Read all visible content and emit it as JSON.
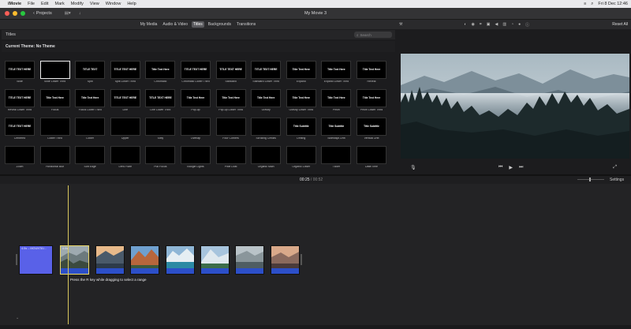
{
  "menubar": {
    "app": "iMovie",
    "items": [
      "File",
      "Edit",
      "Mark",
      "Modify",
      "View",
      "Window",
      "Help"
    ],
    "clock": "Fri 8 Dec  12:46"
  },
  "toolbar": {
    "projects_label": "Projects",
    "window_title": "My Movie 3"
  },
  "tabs": [
    {
      "label": "My Media",
      "active": false
    },
    {
      "label": "Audio & Video",
      "active": false
    },
    {
      "label": "Titles",
      "active": true
    },
    {
      "label": "Backgrounds",
      "active": false
    },
    {
      "label": "Transitions",
      "active": false
    }
  ],
  "viewer_toolbar": {
    "reset_label": "Reset All"
  },
  "browser": {
    "heading": "Titles",
    "search_placeholder": "Search",
    "current_theme": "Current Theme: No Theme"
  },
  "titles": [
    {
      "name": "Slide",
      "thumb": "TITLE TEXT HERE"
    },
    {
      "name": "Slide Lower Third",
      "thumb": "",
      "selected": true
    },
    {
      "name": "Split",
      "thumb": "TITLE TEXT"
    },
    {
      "name": "Split Lower Third",
      "thumb": "TITLE TEXT HERE"
    },
    {
      "name": "Chromatic",
      "thumb": "Title Text Here"
    },
    {
      "name": "Chromatic Lower Third",
      "thumb": "TITLE TEXT HERE"
    },
    {
      "name": "Standard",
      "thumb": "TITLE TEXT HERE"
    },
    {
      "name": "Standard Lower Third",
      "thumb": "TITLE TEXT HERE"
    },
    {
      "name": "Expand",
      "thumb": "Title Text Here"
    },
    {
      "name": "Expand Lower Third",
      "thumb": "Title Text Here"
    },
    {
      "name": "Reveal",
      "thumb": "Title Text Here"
    },
    {
      "name": "Reveal Lower Third",
      "thumb": "TITLE TEXT HERE"
    },
    {
      "name": "Focus",
      "thumb": "Title Text Here"
    },
    {
      "name": "Focus Lower Third",
      "thumb": "Title Text Here"
    },
    {
      "name": "Line",
      "thumb": "TITLE TEXT HERE"
    },
    {
      "name": "Line Lower Third",
      "thumb": "TITLE TEXT HERE"
    },
    {
      "name": "Pop-up",
      "thumb": "Title Text Here"
    },
    {
      "name": "Pop-up Lower Third",
      "thumb": "Title Text Here"
    },
    {
      "name": "Gravity",
      "thumb": "Title Text Here"
    },
    {
      "name": "Gravity Lower Third",
      "thumb": "Title Text Here"
    },
    {
      "name": "Prism",
      "thumb": "Title Text Here"
    },
    {
      "name": "Prism Lower Third",
      "thumb": "Title Text Here"
    },
    {
      "name": "Centered",
      "thumb": "TITLE TEXT HERE"
    },
    {
      "name": "Lower Third",
      "thumb": ""
    },
    {
      "name": "Lower",
      "thumb": ""
    },
    {
      "name": "Upper",
      "thumb": ""
    },
    {
      "name": "Sixty",
      "thumb": ""
    },
    {
      "name": "Overlap",
      "thumb": ""
    },
    {
      "name": "Four Corners",
      "thumb": ""
    },
    {
      "name": "Scrolling Credits",
      "thumb": ""
    },
    {
      "name": "Drifting",
      "thumb": "Title Subtitle"
    },
    {
      "name": "Sideways Drift",
      "thumb": "Title Subtitle"
    },
    {
      "name": "Vertical Drift",
      "thumb": "Title Subtitle"
    },
    {
      "name": "Zoom",
      "thumb": ""
    },
    {
      "name": "Horizontal Blur",
      "thumb": ""
    },
    {
      "name": "Soft Edge",
      "thumb": ""
    },
    {
      "name": "Lens Flare",
      "thumb": ""
    },
    {
      "name": "Pull Focus",
      "thumb": ""
    },
    {
      "name": "Boogie Lights",
      "thumb": ""
    },
    {
      "name": "Pixie Dust",
      "thumb": ""
    },
    {
      "name": "Organic Main",
      "thumb": ""
    },
    {
      "name": "Organic Lower",
      "thumb": ""
    },
    {
      "name": "Ticker",
      "thumb": ""
    },
    {
      "name": "Date/Time",
      "thumb": ""
    }
  ],
  "timeline": {
    "current": "00:25",
    "separator": "/",
    "total": "00:52",
    "settings_label": "Settings",
    "title_clip_label": "4.0s – MOUNTAI...",
    "selected_clip_label": "4.0s",
    "hint": "Press the R key while dragging to select a range"
  },
  "colors": {
    "accent_strip": "#2c4fc9",
    "title_clip": "#5961e8",
    "playhead": "#d7c65c"
  }
}
